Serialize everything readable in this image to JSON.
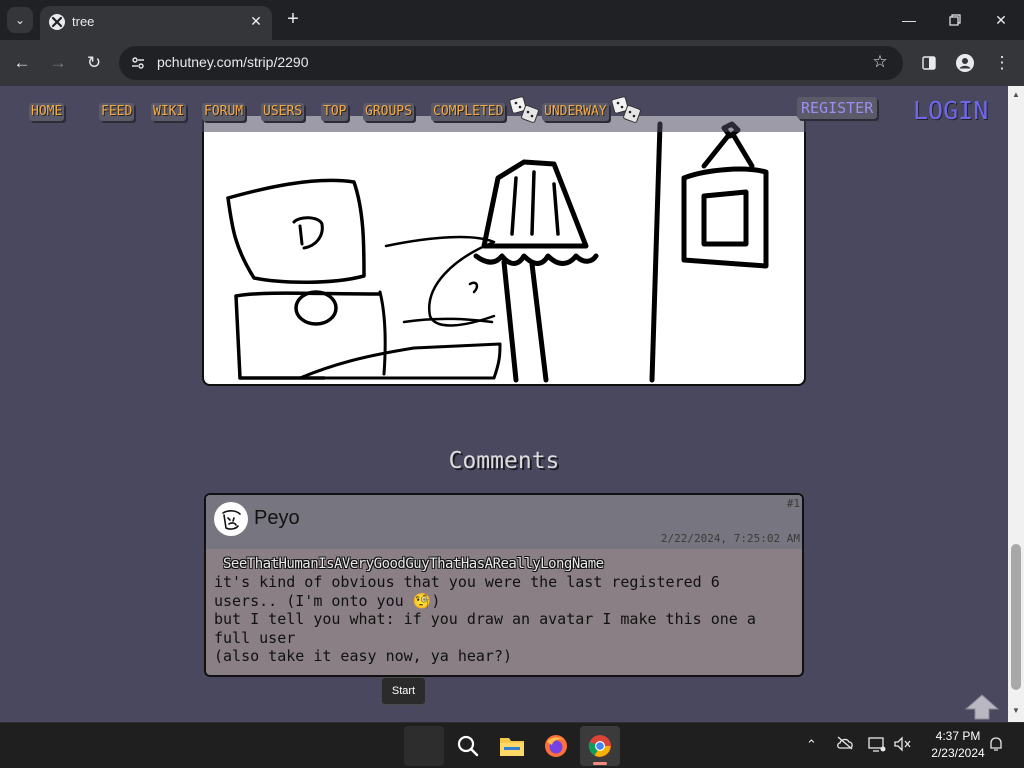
{
  "browser": {
    "tab_title": "tree",
    "url": "pchutney.com/strip/2290",
    "icons": {
      "tab_search": "chevron-down-icon",
      "tab_close": "close-icon",
      "new_tab": "plus-icon",
      "back": "arrow-left-icon",
      "forward": "arrow-right-icon",
      "reload": "reload-icon",
      "site_info": "tune-icon",
      "bookmark": "star-icon",
      "side_panel": "side-panel-icon",
      "profile": "profile-icon",
      "menu": "kebab-menu-icon"
    }
  },
  "site_nav": {
    "links": [
      "HOME",
      "FEED",
      "WIKI",
      "FORUM",
      "USERS",
      "TOP",
      "GROUPS",
      "COMPLETED",
      "UNDERWAY"
    ],
    "register": "REGISTER",
    "login": "LOGIN",
    "colors": {
      "link": "#f2a94a",
      "login": "#7066e8",
      "register": "#9a8ff0",
      "page_bg": "#4a485f"
    }
  },
  "comments_section": {
    "title": "Comments",
    "items": [
      {
        "number": "#1",
        "author": "Peyo",
        "date": "2/22/2024, 7:25:02 AM",
        "mention": "SeeThatHumanIsAVeryGoodGuyThatHasAReallyLongName",
        "lines": [
          "it's kind of obvious that you were the last registered 6",
          "users.. (I'm onto you 🧐)",
          "but I tell you what: if you draw an avatar I make this one a",
          "full user",
          "(also take it easy now, ya hear?)"
        ]
      }
    ]
  },
  "tooltip": "Start",
  "taskbar": {
    "apps": [
      "start",
      "search",
      "file-explorer",
      "firefox",
      "chrome"
    ],
    "time": "4:37 PM",
    "date": "2/23/2024"
  }
}
